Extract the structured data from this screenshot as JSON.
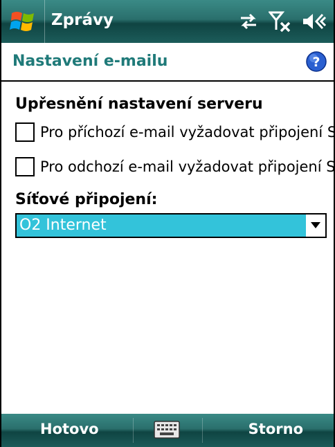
{
  "titlebar": {
    "app_title": "Zprávy",
    "icons": [
      "windows-start-icon",
      "sync-arrows-icon",
      "no-signal-icon",
      "speaker-muted-icon"
    ]
  },
  "header": {
    "title": "Nastavení e-mailu",
    "help_icon": "help-icon"
  },
  "content": {
    "section_heading": "Upřesnění nastavení serveru",
    "checkboxes": [
      {
        "label": "Pro příchozí e-mail vyžadovat připojení SSL",
        "checked": false
      },
      {
        "label": "Pro odchozí e-mail vyžadovat připojení SSL",
        "checked": false
      }
    ],
    "network_label": "Síťové připojení:",
    "network_value": "O2 Internet"
  },
  "menubar": {
    "left_softkey": "Hotovo",
    "right_softkey": "Storno",
    "center_icon": "keyboard-icon"
  },
  "colors": {
    "title_gradient": "#2a6f6c",
    "header_title": "#1f7a79",
    "selection": "#33c3da"
  }
}
